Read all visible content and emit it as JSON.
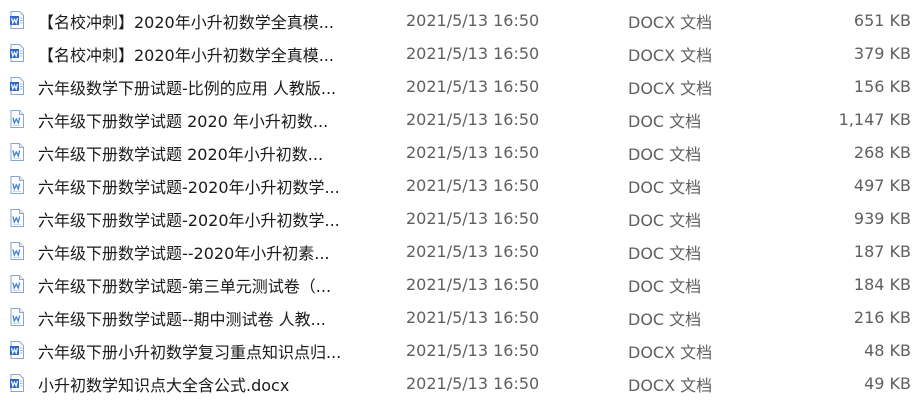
{
  "files": [
    {
      "name": "【名校冲刺】2020年小升初数学全真模...",
      "date": "2021/5/13 16:50",
      "type": "DOCX 文档",
      "size": "651 KB",
      "icon": "docx-icon"
    },
    {
      "name": "【名校冲刺】2020年小升初数学全真模...",
      "date": "2021/5/13 16:50",
      "type": "DOCX 文档",
      "size": "379 KB",
      "icon": "docx-icon"
    },
    {
      "name": "六年级数学下册试题-比例的应用  人教版...",
      "date": "2021/5/13 16:50",
      "type": "DOCX 文档",
      "size": "156 KB",
      "icon": "docx-icon"
    },
    {
      "name": "六年级下册数学试题   2020 年小升初数...",
      "date": "2021/5/13 16:50",
      "type": "DOC 文档",
      "size": "1,147 KB",
      "icon": "doc-icon"
    },
    {
      "name": "六年级下册数学试题   2020年小升初数...",
      "date": "2021/5/13 16:50",
      "type": "DOC 文档",
      "size": "268 KB",
      "icon": "doc-icon"
    },
    {
      "name": "六年级下册数学试题-2020年小升初数学...",
      "date": "2021/5/13 16:50",
      "type": "DOC 文档",
      "size": "497 KB",
      "icon": "doc-icon"
    },
    {
      "name": "六年级下册数学试题-2020年小升初数学...",
      "date": "2021/5/13 16:50",
      "type": "DOC 文档",
      "size": "939 KB",
      "icon": "doc-icon"
    },
    {
      "name": "六年级下册数学试题--2020年小升初素...",
      "date": "2021/5/13 16:50",
      "type": "DOC 文档",
      "size": "187 KB",
      "icon": "doc-icon"
    },
    {
      "name": "六年级下册数学试题-第三单元测试卷（...",
      "date": "2021/5/13 16:50",
      "type": "DOC 文档",
      "size": "184 KB",
      "icon": "doc-icon"
    },
    {
      "name": "六年级下册数学试题--期中测试卷  人教...",
      "date": "2021/5/13 16:50",
      "type": "DOC 文档",
      "size": "216 KB",
      "icon": "doc-icon"
    },
    {
      "name": "六年级下册小升初数学复习重点知识点归...",
      "date": "2021/5/13 16:50",
      "type": "DOCX 文档",
      "size": "48 KB",
      "icon": "docx-icon"
    },
    {
      "name": "小升初数学知识点大全含公式.docx",
      "date": "2021/5/13 16:50",
      "type": "DOCX 文档",
      "size": "49 KB",
      "icon": "docx-icon"
    }
  ],
  "colors": {
    "docx_icon": "#2b6ac7",
    "doc_icon": "#3d7fd9",
    "hover": "#e5f3ff"
  }
}
